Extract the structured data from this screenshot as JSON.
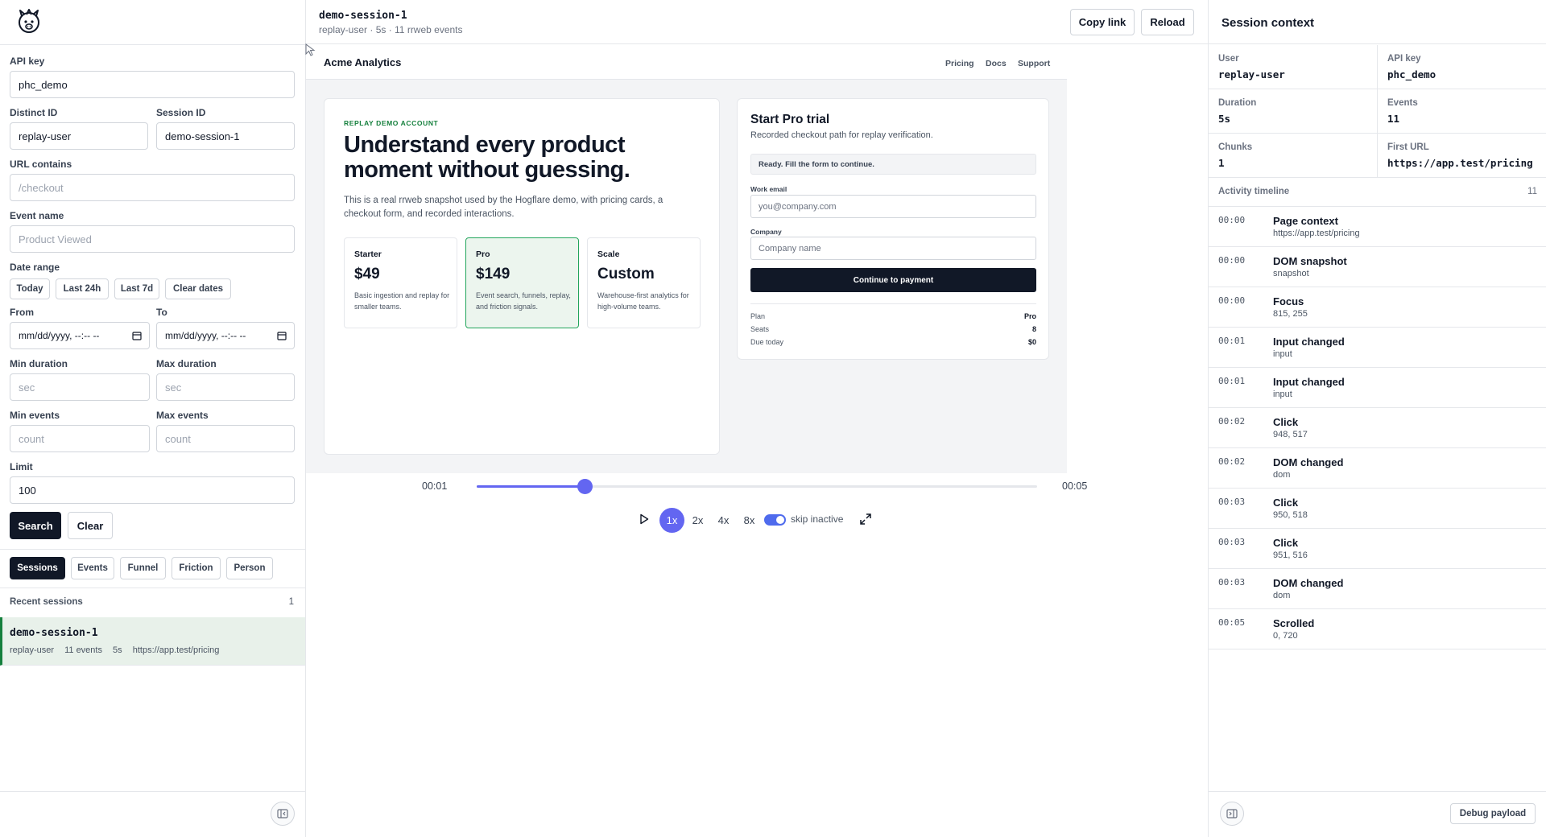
{
  "filters": {
    "api_key": {
      "label": "API key",
      "value": "phc_demo"
    },
    "distinct_id": {
      "label": "Distinct ID",
      "value": "replay-user"
    },
    "session_id": {
      "label": "Session ID",
      "value": "demo-session-1"
    },
    "url_contains": {
      "label": "URL contains",
      "placeholder": "/checkout"
    },
    "event_name": {
      "label": "Event name",
      "placeholder": "Product Viewed"
    },
    "date_range": {
      "label": "Date range",
      "chips": [
        "Today",
        "Last 24h",
        "Last 7d",
        "Clear dates"
      ]
    },
    "from": {
      "label": "From",
      "placeholder": "mm/dd/yyyy, --:-- --"
    },
    "to": {
      "label": "To",
      "placeholder": "mm/dd/yyyy, --:-- --"
    },
    "min_duration": {
      "label": "Min duration",
      "placeholder": "sec"
    },
    "max_duration": {
      "label": "Max duration",
      "placeholder": "sec"
    },
    "min_events": {
      "label": "Min events",
      "placeholder": "count"
    },
    "max_events": {
      "label": "Max events",
      "placeholder": "count"
    },
    "limit": {
      "label": "Limit",
      "value": "100"
    },
    "search_label": "Search",
    "clear_label": "Clear"
  },
  "view_tabs": [
    "Sessions",
    "Events",
    "Funnel",
    "Friction",
    "Person"
  ],
  "recent": {
    "label": "Recent sessions",
    "count": "1",
    "session": {
      "id": "demo-session-1",
      "user": "replay-user",
      "events": "11 events",
      "duration": "5s",
      "url": "https://app.test/pricing"
    }
  },
  "header": {
    "title": "demo-session-1",
    "subtitle": "replay-user · 5s · 11 rrweb events",
    "copy_label": "Copy link",
    "reload_label": "Reload"
  },
  "replay": {
    "brand": "Acme Analytics",
    "nav": [
      "Pricing",
      "Docs",
      "Support"
    ],
    "eyebrow": "REPLAY DEMO ACCOUNT",
    "headline": "Understand every product moment without guessing.",
    "lede": "This is a real rrweb snapshot used by the Hogflare demo, with pricing cards, a checkout form, and recorded interactions.",
    "plans": [
      {
        "name": "Starter",
        "price": "$49",
        "desc": "Basic ingestion and replay for smaller teams."
      },
      {
        "name": "Pro",
        "price": "$149",
        "desc": "Event search, funnels, replay, and friction signals."
      },
      {
        "name": "Scale",
        "price": "Custom",
        "desc": "Warehouse-first analytics for high-volume teams."
      }
    ],
    "trial": {
      "title": "Start Pro trial",
      "subtitle": "Recorded checkout path for replay verification.",
      "status": "Ready. Fill the form to continue.",
      "email_label": "Work email",
      "email_placeholder": "you@company.com",
      "company_label": "Company",
      "company_placeholder": "Company name",
      "cta": "Continue to payment",
      "summary": [
        {
          "k": "Plan",
          "v": "Pro"
        },
        {
          "k": "Seats",
          "v": "8"
        },
        {
          "k": "Due today",
          "v": "$0"
        }
      ]
    }
  },
  "player": {
    "current": "00:01",
    "total": "00:05",
    "progress_fraction": 0.193,
    "speeds": [
      "1x",
      "2x",
      "4x",
      "8x"
    ],
    "skip_label": "skip inactive",
    "accent": "#6366f1"
  },
  "context": {
    "title": "Session context",
    "stats": [
      {
        "k": "User",
        "v": "replay-user"
      },
      {
        "k": "API key",
        "v": "phc_demo"
      },
      {
        "k": "Duration",
        "v": "5s"
      },
      {
        "k": "Events",
        "v": "11"
      },
      {
        "k": "Chunks",
        "v": "1"
      },
      {
        "k": "First URL",
        "v": "https://app.test/pricing"
      }
    ],
    "timeline_label": "Activity timeline",
    "timeline_count": "11",
    "events": [
      {
        "t": "00:00",
        "name": "Page context",
        "detail": "https://app.test/pricing"
      },
      {
        "t": "00:00",
        "name": "DOM snapshot",
        "detail": "snapshot"
      },
      {
        "t": "00:00",
        "name": "Focus",
        "detail": "815, 255"
      },
      {
        "t": "00:01",
        "name": "Input changed",
        "detail": "input"
      },
      {
        "t": "00:01",
        "name": "Input changed",
        "detail": "input"
      },
      {
        "t": "00:02",
        "name": "Click",
        "detail": "948, 517"
      },
      {
        "t": "00:02",
        "name": "DOM changed",
        "detail": "dom"
      },
      {
        "t": "00:03",
        "name": "Click",
        "detail": "950, 518"
      },
      {
        "t": "00:03",
        "name": "Click",
        "detail": "951, 516"
      },
      {
        "t": "00:03",
        "name": "DOM changed",
        "detail": "dom"
      },
      {
        "t": "00:05",
        "name": "Scrolled",
        "detail": "0, 720"
      }
    ],
    "debug_label": "Debug payload"
  }
}
